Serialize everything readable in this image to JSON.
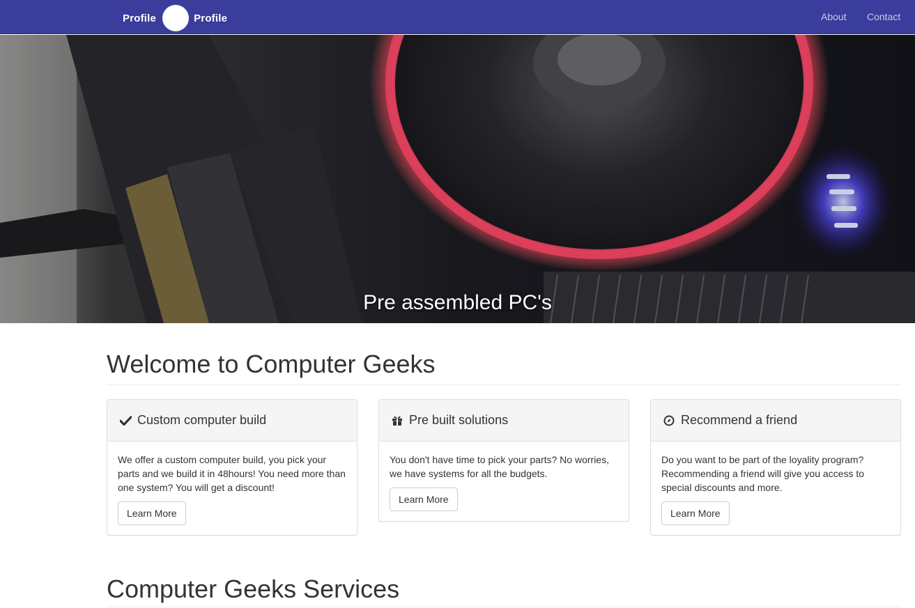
{
  "navbar": {
    "brand_left": "Profile",
    "brand_right": "Profile",
    "links": [
      "About",
      "Contact"
    ]
  },
  "carousel": {
    "caption": "Pre assembled PC's",
    "slide_count": 3,
    "active_index": 1
  },
  "welcome": {
    "title": "Welcome to Computer Geeks"
  },
  "panels": [
    {
      "icon": "check-icon",
      "title": "Custom computer build",
      "text": "We offer a custom computer build, you pick your parts and we build it in 48hours! You need more than one system? You will get a discount!",
      "button": "Learn More"
    },
    {
      "icon": "gift-icon",
      "title": "Pre built solutions",
      "text": "You don't have time to pick your parts? No worries, we have systems for all the budgets.",
      "button": "Learn More"
    },
    {
      "icon": "compass-icon",
      "title": "Recommend a friend",
      "text": "Do you want to be part of the loyality program? Recommending a friend will give you access to special discounts and more.",
      "button": "Learn More"
    }
  ],
  "services": {
    "title": "Computer Geeks Services"
  },
  "colors": {
    "navbar": "#3a3d9c",
    "nav_link": "#c9cae8",
    "panel_heading_bg": "#f5f5f5"
  }
}
